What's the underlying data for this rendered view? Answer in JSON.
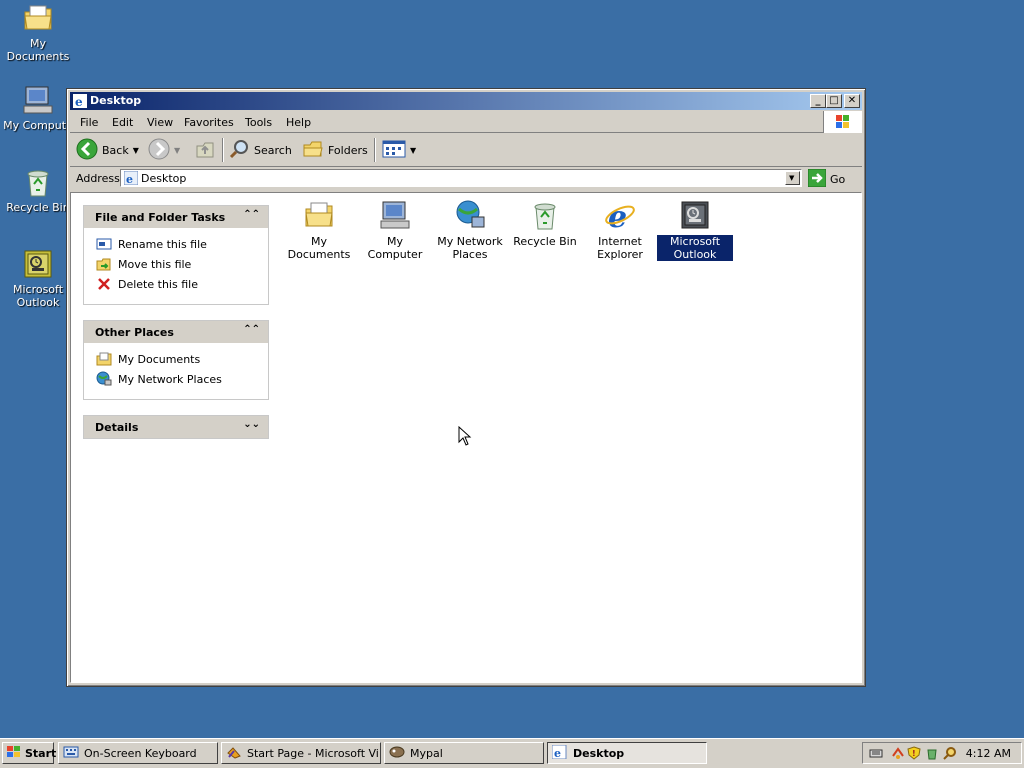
{
  "desktop_icons": [
    {
      "label": "My Documents",
      "icon": "my-documents-icon"
    },
    {
      "label": "My Compute",
      "icon": "my-computer-icon"
    },
    {
      "label": "Recycle Bin",
      "icon": "recycle-bin-icon"
    },
    {
      "label": "Microsoft Outlook",
      "icon": "outlook-icon"
    }
  ],
  "window": {
    "title": "Desktop",
    "menu": [
      "File",
      "Edit",
      "View",
      "Favorites",
      "Tools",
      "Help"
    ],
    "toolbar": {
      "back": "Back",
      "search": "Search",
      "folders": "Folders"
    },
    "address": {
      "label": "Address",
      "value": "Desktop",
      "go": "Go"
    }
  },
  "panels": {
    "file_tasks": {
      "title": "File and Folder Tasks",
      "items": [
        "Rename this file",
        "Move this file",
        "Delete this file"
      ]
    },
    "other_places": {
      "title": "Other Places",
      "items": [
        "My Documents",
        "My Network Places"
      ]
    },
    "details": {
      "title": "Details"
    }
  },
  "files": [
    {
      "label": "My Documents",
      "icon": "my-documents-icon"
    },
    {
      "label": "My Computer",
      "icon": "my-computer-icon"
    },
    {
      "label": "My Network Places",
      "icon": "network-places-icon"
    },
    {
      "label": "Recycle Bin",
      "icon": "recycle-bin-icon"
    },
    {
      "label": "Internet Explorer",
      "icon": "internet-explorer-icon"
    },
    {
      "label": "Microsoft Outlook",
      "icon": "outlook-icon",
      "selected": true
    }
  ],
  "taskbar": {
    "start": "Start",
    "tasks": [
      "On-Screen Keyboard",
      "Start Page - Microsoft Vi...",
      "Mypal",
      "Desktop"
    ],
    "clock": "4:12 AM"
  },
  "colors": {
    "desktop": "#3a6ea5",
    "title_active": "#0a246a",
    "selection": "#0a246a"
  }
}
